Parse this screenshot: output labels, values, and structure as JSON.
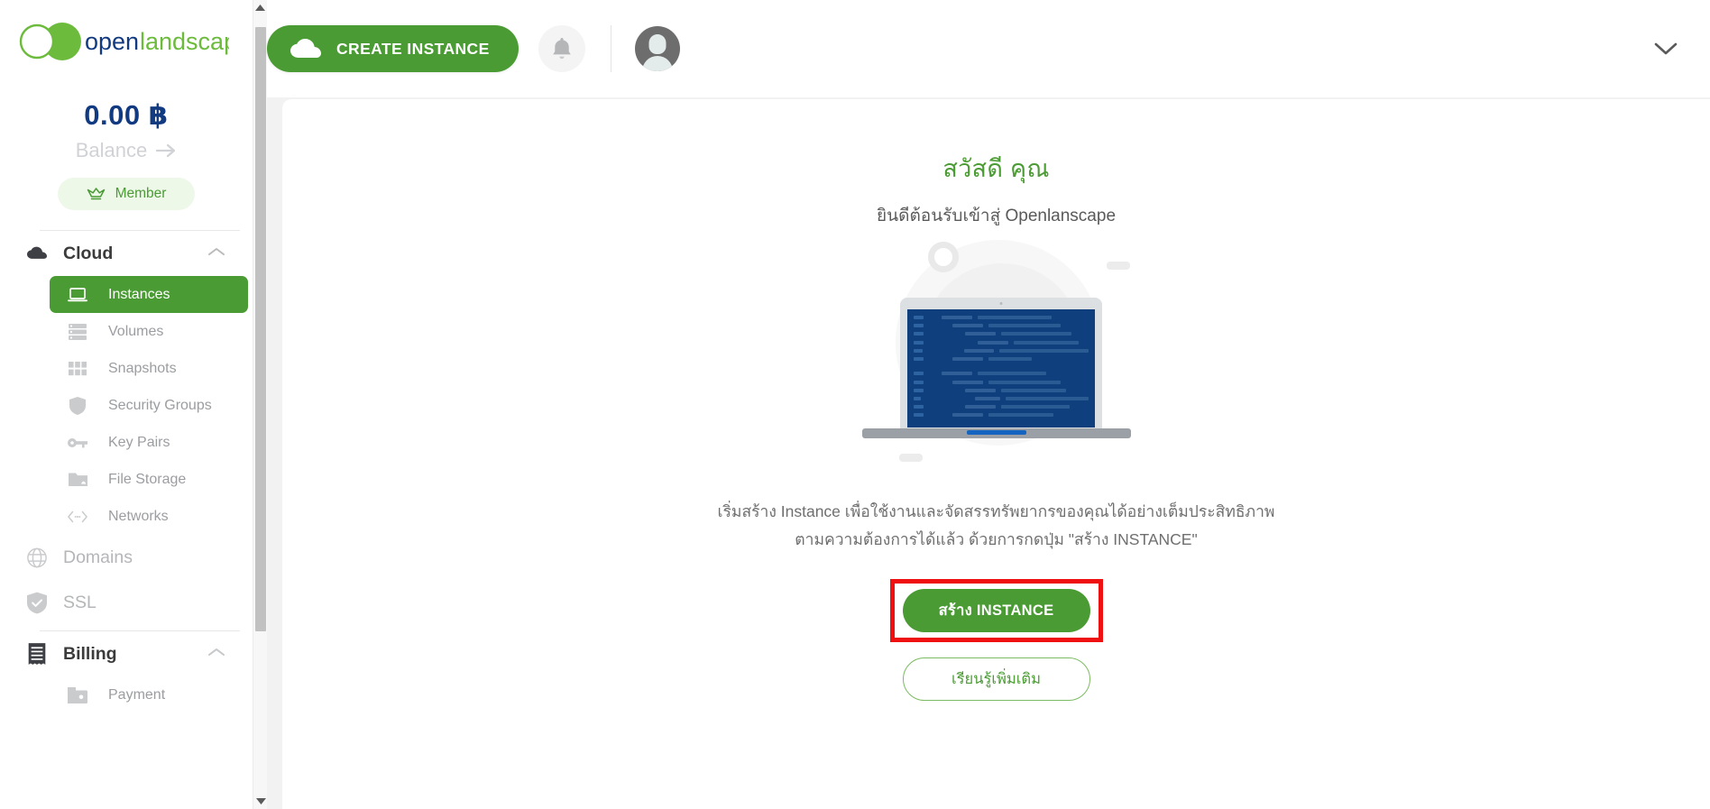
{
  "brand": {
    "name_part1": "open",
    "name_part2": "landscape",
    "accent_green": "#6cbb3c",
    "accent_navy": "#123a80",
    "primary_green": "#4a9b33",
    "highlight_red": "#ef1111"
  },
  "sidebar": {
    "balance_amount": "0.00 ฿",
    "balance_label": "Balance",
    "member_badge": "Member",
    "groups": [
      {
        "label": "Cloud",
        "icon": "cloud-icon",
        "expanded": true,
        "items": [
          {
            "label": "Instances",
            "icon": "laptop-icon",
            "active": true
          },
          {
            "label": "Volumes",
            "icon": "server-icon",
            "active": false
          },
          {
            "label": "Snapshots",
            "icon": "grid-icon",
            "active": false
          },
          {
            "label": "Security Groups",
            "icon": "shield-icon",
            "active": false
          },
          {
            "label": "Key Pairs",
            "icon": "key-icon",
            "active": false
          },
          {
            "label": "File Storage",
            "icon": "folder-icon",
            "active": false
          },
          {
            "label": "Networks",
            "icon": "network-icon",
            "active": false
          }
        ]
      },
      {
        "label": "Domains",
        "icon": "globe-icon",
        "expanded": false,
        "items": []
      },
      {
        "label": "SSL",
        "icon": "shield-check-icon",
        "expanded": false,
        "items": []
      },
      {
        "label": "Billing",
        "icon": "receipt-icon",
        "expanded": true,
        "items": [
          {
            "label": "Payment",
            "icon": "wallet-icon",
            "active": false
          }
        ]
      }
    ]
  },
  "header": {
    "create_instance_label": "CREATE INSTANCE",
    "create_instance_icon": "cloud-icon",
    "notification_icon": "bell-icon",
    "avatar_icon": "user-avatar",
    "account_caret_icon": "chevron-down-icon"
  },
  "main": {
    "greeting": "สวัสดี คุณ",
    "welcome": "ยินดีต้อนรับเข้าสู่ Openlanscape",
    "description_line1": "เริ่มสร้าง Instance เพื่อใช้งานและจัดสรรทรัพยากรของคุณได้อย่างเต็มประสิทธิภาพ",
    "description_line2": "ตามความต้องการได้แล้ว ด้วยการกดปุ่ม \"สร้าง INSTANCE\"",
    "primary_button": "สร้าง INSTANCE",
    "secondary_button": "เรียนรู้เพิ่มเติม",
    "illustration": "laptop-with-code-illustration"
  }
}
